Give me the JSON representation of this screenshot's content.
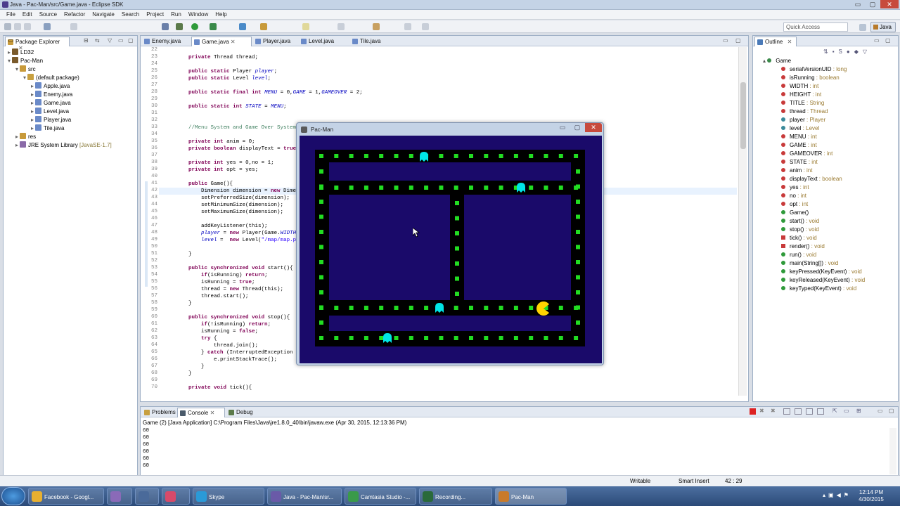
{
  "window": {
    "title": "Java - Pac-Man/src/Game.java - Eclipse SDK",
    "minimize": "▭",
    "maximize": "▢",
    "close": "✕"
  },
  "menu": [
    "File",
    "Edit",
    "Source",
    "Refactor",
    "Navigate",
    "Search",
    "Project",
    "Run",
    "Window",
    "Help"
  ],
  "toolbar": {
    "quick_access_placeholder": "Quick Access",
    "perspective": "Java"
  },
  "package_explorer": {
    "tab": "Package Explorer",
    "items": [
      {
        "label": "LD32",
        "indent": 0
      },
      {
        "label": "Pac-Man",
        "indent": 0
      },
      {
        "label": "src",
        "indent": 1
      },
      {
        "label": "(default package)",
        "indent": 2
      },
      {
        "label": "Apple.java",
        "indent": 3
      },
      {
        "label": "Enemy.java",
        "indent": 3
      },
      {
        "label": "Game.java",
        "indent": 3
      },
      {
        "label": "Level.java",
        "indent": 3
      },
      {
        "label": "Player.java",
        "indent": 3
      },
      {
        "label": "Tile.java",
        "indent": 3
      },
      {
        "label": "res",
        "indent": 1
      },
      {
        "label": "JRE System Library",
        "suffix": "[JavaSE-1.7]",
        "indent": 1
      }
    ]
  },
  "editor": {
    "tabs": [
      "Enemy.java",
      "Game.java",
      "Player.java",
      "Level.java",
      "Tile.java"
    ],
    "active_tab": "Game.java",
    "lines": [
      {
        "n": "22",
        "t": ""
      },
      {
        "n": "23",
        "t": "    private Thread thread;"
      },
      {
        "n": "24",
        "t": ""
      },
      {
        "n": "25",
        "t": "    public static Player player;"
      },
      {
        "n": "26",
        "t": "    public static Level level;"
      },
      {
        "n": "27",
        "t": ""
      },
      {
        "n": "28",
        "t": "    public static final int MENU = 0,GAME = 1,GAMEOVER = 2;"
      },
      {
        "n": "29",
        "t": ""
      },
      {
        "n": "30",
        "t": "    public static int STATE = MENU;"
      },
      {
        "n": "31",
        "t": ""
      },
      {
        "n": "32",
        "t": ""
      },
      {
        "n": "33",
        "t": "    //Menu System and Game Over System"
      },
      {
        "n": "34",
        "t": ""
      },
      {
        "n": "35",
        "t": "    private int anim = 0;"
      },
      {
        "n": "36",
        "t": "    private boolean displayText = true;"
      },
      {
        "n": "37",
        "t": ""
      },
      {
        "n": "38",
        "t": "    private int yes = 0,no = 1;"
      },
      {
        "n": "39",
        "t": "    private int opt = yes;"
      },
      {
        "n": "40",
        "t": ""
      },
      {
        "n": "41",
        "t": "    public Game(){"
      },
      {
        "n": "42",
        "t": "        Dimension dimension = new Dimensi"
      },
      {
        "n": "43",
        "t": "        setPreferredSize(dimension);"
      },
      {
        "n": "44",
        "t": "        setMinimumSize(dimension);"
      },
      {
        "n": "45",
        "t": "        setMaximumSize(dimension);"
      },
      {
        "n": "46",
        "t": ""
      },
      {
        "n": "47",
        "t": "        addKeyListener(this);"
      },
      {
        "n": "48",
        "t": "        player = new Player(Game.WIDTH/2,"
      },
      {
        "n": "49",
        "t": "        level =  new Level(\"/map/map.png\""
      },
      {
        "n": "50",
        "t": ""
      },
      {
        "n": "51",
        "t": "    }"
      },
      {
        "n": "52",
        "t": ""
      },
      {
        "n": "53",
        "t": "    public synchronized void start(){"
      },
      {
        "n": "54",
        "t": "        if(isRunning) return;"
      },
      {
        "n": "55",
        "t": "        isRunning = true;"
      },
      {
        "n": "56",
        "t": "        thread = new Thread(this);"
      },
      {
        "n": "57",
        "t": "        thread.start();"
      },
      {
        "n": "58",
        "t": "    }"
      },
      {
        "n": "59",
        "t": ""
      },
      {
        "n": "60",
        "t": "    public synchronized void stop(){"
      },
      {
        "n": "61",
        "t": "        if(!isRunning) return;"
      },
      {
        "n": "62",
        "t": "        isRunning = false;"
      },
      {
        "n": "63",
        "t": "        try {"
      },
      {
        "n": "64",
        "t": "            thread.join();"
      },
      {
        "n": "65",
        "t": "        } catch (InterruptedException e)"
      },
      {
        "n": "66",
        "t": "            e.printStackTrace();"
      },
      {
        "n": "67",
        "t": "        }"
      },
      {
        "n": "68",
        "t": "    }"
      },
      {
        "n": "69",
        "t": ""
      },
      {
        "n": "70",
        "t": "    private void tick(){"
      }
    ]
  },
  "outline": {
    "tab": "Outline",
    "root": "Game",
    "items": [
      {
        "name": "serialVersionUID",
        "type": " : long"
      },
      {
        "name": "isRunning",
        "type": " : boolean"
      },
      {
        "name": "WIDTH",
        "type": " : int"
      },
      {
        "name": "HEIGHT",
        "type": " : int"
      },
      {
        "name": "TITLE",
        "type": " : String"
      },
      {
        "name": "thread",
        "type": " : Thread"
      },
      {
        "name": "player",
        "type": " : Player"
      },
      {
        "name": "level",
        "type": " : Level"
      },
      {
        "name": "MENU",
        "type": " : int"
      },
      {
        "name": "GAME",
        "type": " : int"
      },
      {
        "name": "GAMEOVER",
        "type": " : int"
      },
      {
        "name": "STATE",
        "type": " : int"
      },
      {
        "name": "anim",
        "type": " : int"
      },
      {
        "name": "displayText",
        "type": " : boolean"
      },
      {
        "name": "yes",
        "type": " : int"
      },
      {
        "name": "no",
        "type": " : int"
      },
      {
        "name": "opt",
        "type": " : int"
      },
      {
        "name": "Game()",
        "type": ""
      },
      {
        "name": "start()",
        "type": " : void"
      },
      {
        "name": "stop()",
        "type": " : void"
      },
      {
        "name": "tick()",
        "type": " : void"
      },
      {
        "name": "render()",
        "type": " : void"
      },
      {
        "name": "run()",
        "type": " : void"
      },
      {
        "name": "main(String[])",
        "type": " : void"
      },
      {
        "name": "keyPressed(KeyEvent)",
        "type": " : void"
      },
      {
        "name": "keyReleased(KeyEvent)",
        "type": " : void"
      },
      {
        "name": "keyTyped(KeyEvent)",
        "type": " : void"
      }
    ]
  },
  "console": {
    "tabs": [
      "Problems",
      "Console",
      "Debug"
    ],
    "header": "Game (2) [Java Application] C:\\Program Files\\Java\\jre1.8.0_40\\bin\\javaw.exe (Apr 30, 2015, 12:13:36 PM)",
    "lines": [
      "60",
      "60",
      "60",
      "60",
      "60",
      "60"
    ]
  },
  "status": {
    "writable": "Writable",
    "insert": "Smart Insert",
    "position": "42 : 29"
  },
  "game_window": {
    "title": "Pac-Man"
  },
  "colors": {
    "board": "#1a0a6a",
    "wall": "#000000",
    "dot": "#22dd22",
    "ghost": "#00e5e5",
    "pacman": "#ffd400",
    "accent": "#4b3c8c"
  },
  "taskbar": {
    "items": [
      "Facebook - Googl...",
      "",
      "",
      "",
      "Skype",
      "Java - Pac-Man/sr...",
      "Camtasia Studio -...",
      "Recording...",
      "Pac-Man"
    ],
    "time": "12:14 PM",
    "date": "4/30/2015"
  }
}
